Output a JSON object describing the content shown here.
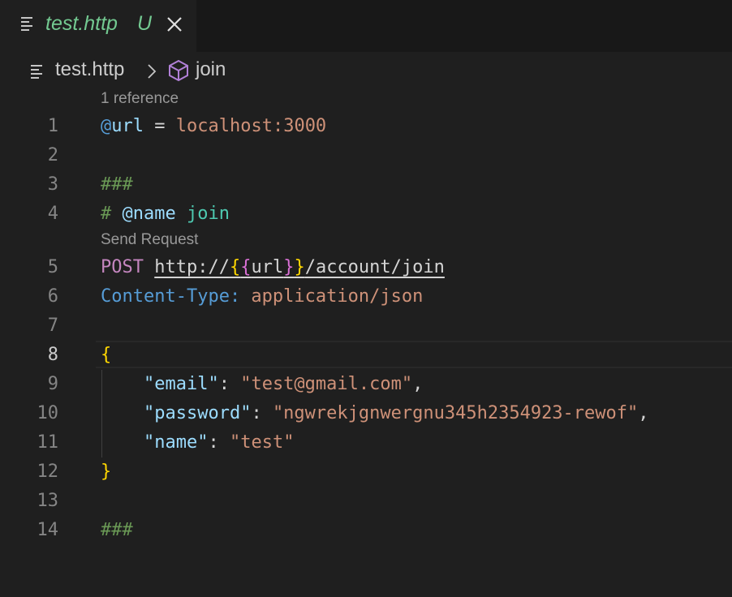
{
  "tab": {
    "name": "test.http",
    "status": "U"
  },
  "breadcrumb": {
    "file": "test.http",
    "symbol": "join"
  },
  "lenses": {
    "references": "1 reference",
    "send_request": "Send Request"
  },
  "editor": {
    "line_numbers": [
      "1",
      "2",
      "3",
      "4",
      "5",
      "6",
      "7",
      "8",
      "9",
      "10",
      "11",
      "12",
      "13",
      "14"
    ],
    "active_line": "8",
    "lines": {
      "l1": {
        "at": "@",
        "var": "url",
        "eq": " = ",
        "val": "localhost:3000"
      },
      "l3": {
        "comment": "###"
      },
      "l4": {
        "hash": "# ",
        "tag": "@name",
        "name": " join"
      },
      "l5": {
        "method": "POST",
        "url_prefix": "http://",
        "open_braces": "{{",
        "var": "url",
        "close_braces": "}}",
        "url_suffix": "/account/join"
      },
      "l6": {
        "header": "Content-Type:",
        "value": " application/json"
      },
      "l8": {
        "brace": "{"
      },
      "l9": {
        "key": "\"email\"",
        "sep": ": ",
        "value": "\"test@gmail.com\"",
        "comma": ","
      },
      "l10": {
        "key": "\"password\"",
        "sep": ": ",
        "value": "\"ngwrekjgnwergnu345h2354923-rewof\"",
        "comma": ","
      },
      "l11": {
        "key": "\"name\"",
        "sep": ": ",
        "value": "\"test\""
      },
      "l12": {
        "brace": "}"
      },
      "l14": {
        "comment": "###"
      }
    }
  },
  "icons": {
    "tab": "file-lines-icon",
    "close": "close-icon",
    "breadcrumb_file": "file-lines-icon",
    "separator": "chevron-right-icon",
    "symbol": "cube-icon"
  },
  "colors": {
    "background": "#1f1f1f",
    "tab_untracked": "#73c991",
    "comment": "#6a9955",
    "string": "#ce9178",
    "keyword": "#c586c0",
    "variable": "#9cdcfe",
    "bracket": "#ffd700"
  }
}
